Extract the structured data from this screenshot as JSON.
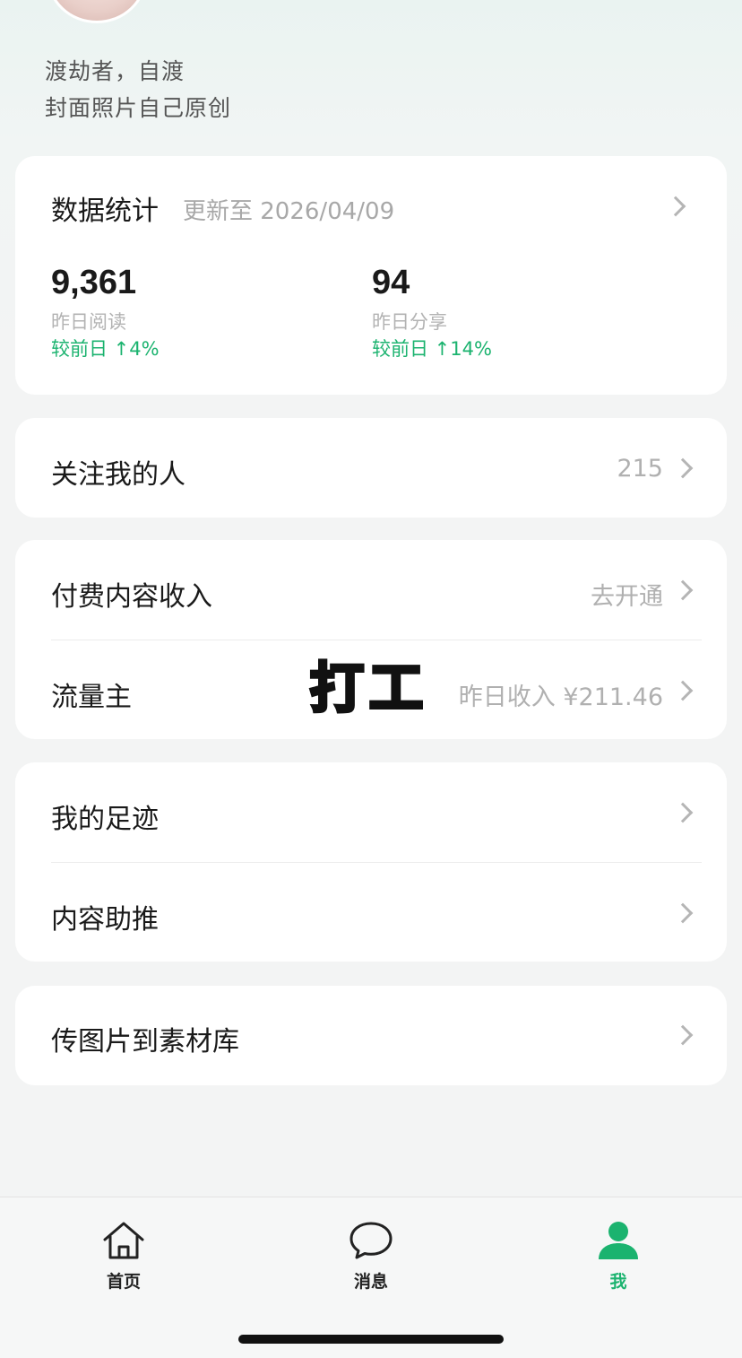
{
  "profile": {
    "bio_line1": "渡劫者，自渡",
    "bio_line2": "封面照片自己原创"
  },
  "stats": {
    "title": "数据统计",
    "updated": "更新至 2026/04/09",
    "reads": {
      "value": "9,361",
      "label": "昨日阅读",
      "change": "较前日 ↑4%"
    },
    "shares": {
      "value": "94",
      "label": "昨日分享",
      "change": "较前日 ↑14%"
    }
  },
  "followers": {
    "label": "关注我的人",
    "count": "215"
  },
  "paid_content": {
    "label": "付费内容收入",
    "action": "去开通"
  },
  "traffic": {
    "label": "流量主",
    "income": "昨日收入 ¥211.46"
  },
  "sticker_text": "打工",
  "footprints": {
    "label": "我的足迹"
  },
  "promote": {
    "label": "内容助推"
  },
  "upload": {
    "label": "传图片到素材库"
  },
  "tabs": {
    "home": "首页",
    "messages": "消息",
    "me": "我"
  },
  "colors": {
    "accent": "#1bb36f",
    "text_muted": "#b0b0b0"
  },
  "icons": [
    "home-icon",
    "chat-bubble-icon",
    "person-icon",
    "chevron-right-icon"
  ]
}
